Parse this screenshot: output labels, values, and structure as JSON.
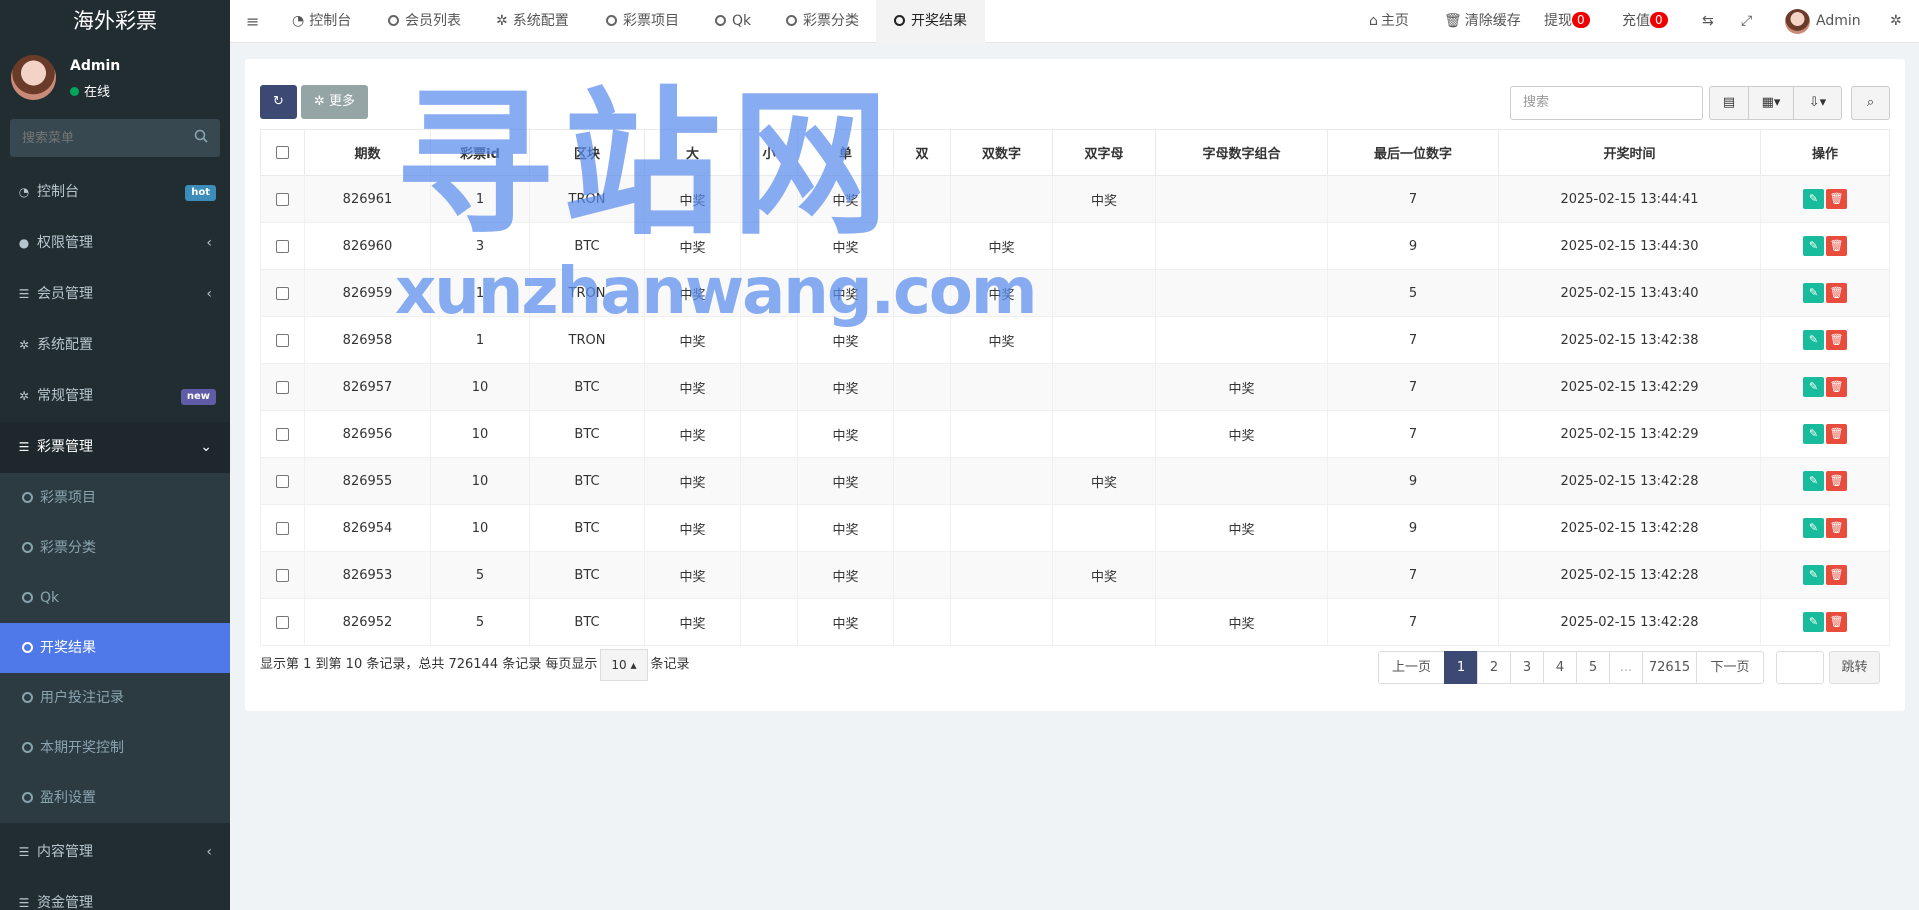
{
  "app": {
    "title": "海外彩票"
  },
  "user": {
    "name": "Admin",
    "status": "在线"
  },
  "sidebar": {
    "search_placeholder": "搜索菜单",
    "items": [
      {
        "label": "控制台",
        "badge": "hot",
        "badge_color": "#3c8dbc"
      },
      {
        "label": "权限管理"
      },
      {
        "label": "会员管理"
      },
      {
        "label": "系统配置"
      },
      {
        "label": "常规管理",
        "badge": "new",
        "badge_color": "#605ca8"
      },
      {
        "label": "彩票管理"
      }
    ],
    "sub_items": [
      "彩票项目",
      "彩票分类",
      "Qk",
      "开奖结果",
      "用户投注记录",
      "本期开奖控制",
      "盈利设置"
    ],
    "after_items": [
      "内容管理",
      "资金管理"
    ]
  },
  "topbar": {
    "tabs": [
      "控制台",
      "会员列表",
      "系统配置",
      "彩票项目",
      "Qk",
      "彩票分类",
      "开奖结果"
    ],
    "home": "主页",
    "clear_cache": "清除缓存",
    "withdraw": "提现",
    "withdraw_count": "0",
    "recharge": "充值",
    "recharge_count": "0",
    "admin": "Admin"
  },
  "toolbar": {
    "more": "更多",
    "search_placeholder": "搜索"
  },
  "table": {
    "headers": [
      "期数",
      "彩票id",
      "区块",
      "大",
      "小",
      "单",
      "双",
      "双数字",
      "双字母",
      "字母数字组合",
      "最后一位数字",
      "开奖时间",
      "操作"
    ],
    "rows": [
      [
        "826961",
        "1",
        "TRON",
        "中奖",
        "",
        "中奖",
        "",
        "",
        "中奖",
        "",
        "7",
        "2025-02-15 13:44:41"
      ],
      [
        "826960",
        "3",
        "BTC",
        "中奖",
        "",
        "中奖",
        "",
        "中奖",
        "",
        "",
        "9",
        "2025-02-15 13:44:30"
      ],
      [
        "826959",
        "1",
        "TRON",
        "中奖",
        "",
        "中奖",
        "",
        "中奖",
        "",
        "",
        "5",
        "2025-02-15 13:43:40"
      ],
      [
        "826958",
        "1",
        "TRON",
        "中奖",
        "",
        "中奖",
        "",
        "中奖",
        "",
        "",
        "7",
        "2025-02-15 13:42:38"
      ],
      [
        "826957",
        "10",
        "BTC",
        "中奖",
        "",
        "中奖",
        "",
        "",
        "",
        "中奖",
        "7",
        "2025-02-15 13:42:29"
      ],
      [
        "826956",
        "10",
        "BTC",
        "中奖",
        "",
        "中奖",
        "",
        "",
        "",
        "中奖",
        "7",
        "2025-02-15 13:42:29"
      ],
      [
        "826955",
        "10",
        "BTC",
        "中奖",
        "",
        "中奖",
        "",
        "",
        "中奖",
        "",
        "9",
        "2025-02-15 13:42:28"
      ],
      [
        "826954",
        "10",
        "BTC",
        "中奖",
        "",
        "中奖",
        "",
        "",
        "",
        "中奖",
        "9",
        "2025-02-15 13:42:28"
      ],
      [
        "826953",
        "5",
        "BTC",
        "中奖",
        "",
        "中奖",
        "",
        "",
        "中奖",
        "",
        "7",
        "2025-02-15 13:42:28"
      ],
      [
        "826952",
        "5",
        "BTC",
        "中奖",
        "",
        "中奖",
        "",
        "",
        "",
        "中奖",
        "7",
        "2025-02-15 13:42:28"
      ]
    ]
  },
  "footer": {
    "info_prefix": "显示第 1 到第 10 条记录，总共 726144 条记录 每页显示",
    "page_size": "10",
    "info_suffix": "条记录",
    "prev": "上一页",
    "pages": [
      "1",
      "2",
      "3",
      "4",
      "5",
      "...",
      "72615"
    ],
    "next": "下一页",
    "jump": "跳转"
  },
  "watermark": {
    "line1": "寻站网",
    "line2": "xunzhanwang.com"
  },
  "colors": {
    "sidebar_bg": "#222d32",
    "active": "#4f79e8",
    "edit": "#18bc9c",
    "delete": "#e74c3c",
    "primary": "#3c4a73"
  }
}
